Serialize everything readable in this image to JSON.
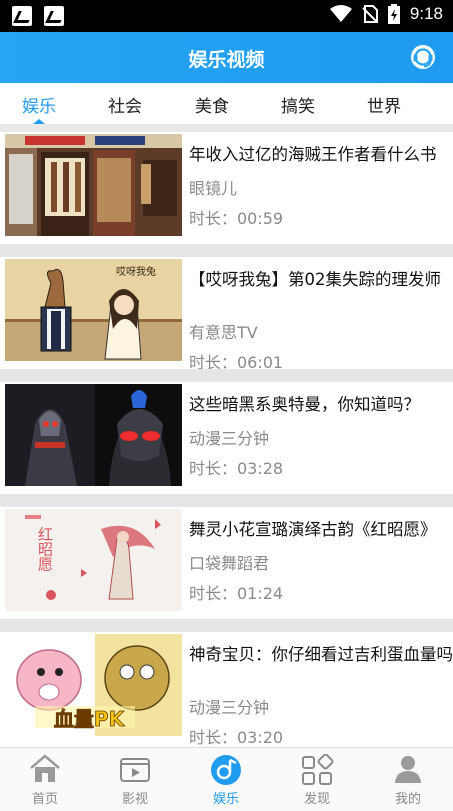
{
  "status_bar": {
    "time": "9:18",
    "icons": [
      "notification-icon",
      "notification-icon",
      "wifi-icon",
      "no-sim-icon",
      "battery-charging-icon"
    ]
  },
  "header": {
    "title": "娱乐视频",
    "service_icon": "customer-service-icon"
  },
  "tabs": [
    "娱乐",
    "社会",
    "美食",
    "搞笑",
    "世界"
  ],
  "active_tab": "娱乐",
  "videos": [
    {
      "title": "年收入过亿的海贼王作者看什么书",
      "channel": "眼镜儿",
      "duration": "时长：00:59"
    },
    {
      "title": "【哎呀我兔】第02集失踪的理发师",
      "channel": "有意思TV",
      "duration": "时长：06:01"
    },
    {
      "title": "这些暗黑系奥特曼，你知道吗？",
      "channel": "动漫三分钟",
      "duration": "时长：03:28"
    },
    {
      "title": "舞灵小花宣璐演绎古韵《红昭愿》",
      "channel": "口袋舞蹈君",
      "duration": "时长：01:24"
    },
    {
      "title": "神奇宝贝：你仔细看过吉利蛋血量吗",
      "channel": "动漫三分钟",
      "duration": "时长：03:20"
    }
  ],
  "thumb_text": {
    "v2_logo": "哎呀我兔",
    "v4_title": "红昭愿",
    "v5_caption": "血量PK"
  },
  "bottom_nav": [
    {
      "label": "首页",
      "icon": "home-icon"
    },
    {
      "label": "影视",
      "icon": "tv-icon"
    },
    {
      "label": "娱乐",
      "icon": "music-disc-icon"
    },
    {
      "label": "发现",
      "icon": "grid-icon"
    },
    {
      "label": "我的",
      "icon": "user-icon"
    }
  ],
  "colors": {
    "accent": "#1f9bf0",
    "header": "#27a5f2",
    "muted": "#8a8a8a"
  }
}
